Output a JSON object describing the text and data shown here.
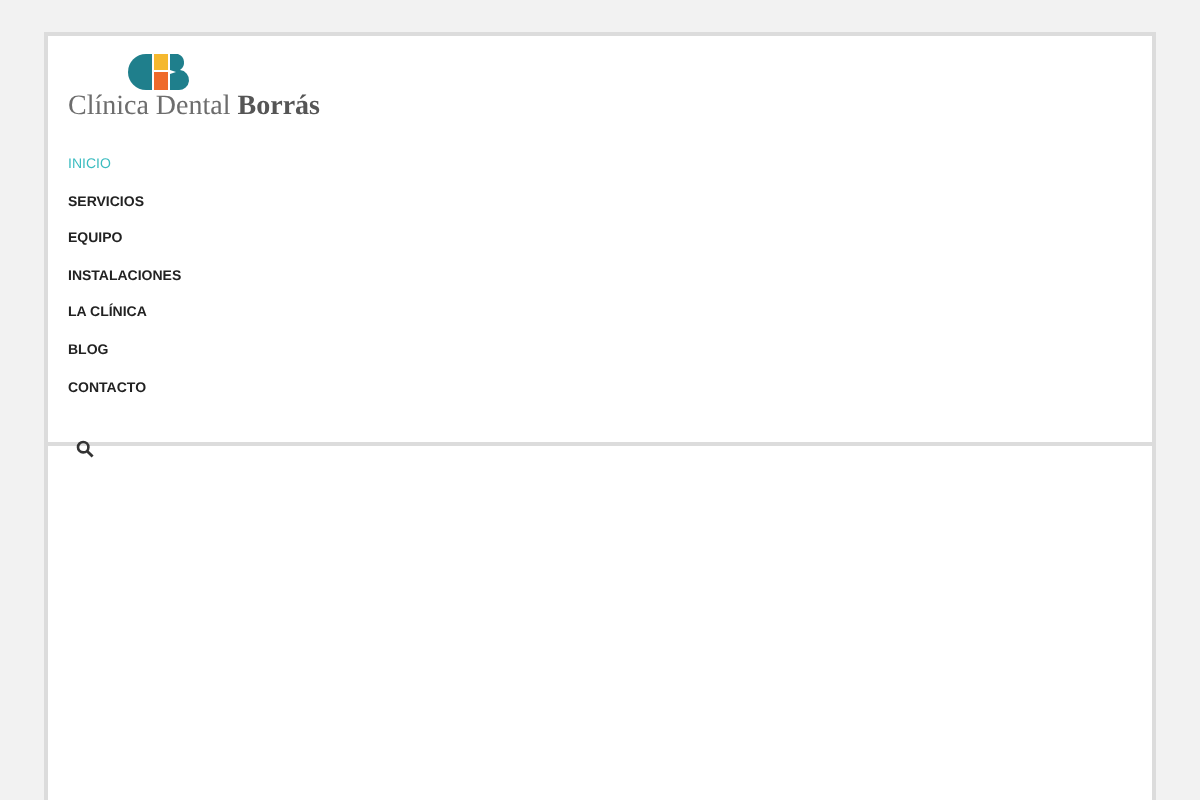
{
  "logo": {
    "text": "Clínica Dental **Borrás**"
  },
  "menu": [
    {
      "label": "INICIO",
      "selected": true
    },
    {
      "label": "SERVICIOS",
      "selected": false
    },
    {
      "label": "EQUIPO",
      "selected": false
    },
    {
      "label": "INSTALACIONES",
      "selected": false
    },
    {
      "label": "LA CLÍNICA",
      "selected": false
    },
    {
      "label": "BLOG",
      "selected": false
    },
    {
      "label": "CONTACTO",
      "selected": false
    }
  ]
}
